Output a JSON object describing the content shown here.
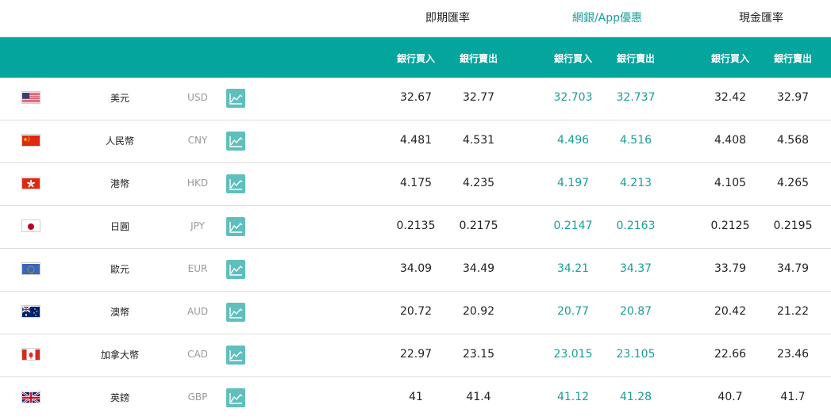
{
  "header": {
    "spot": "即期匯率",
    "online": "網銀/App優惠",
    "cash": "現金匯率",
    "buy": "銀行買入",
    "sell": "銀行賣出"
  },
  "colors": {
    "teal": "#04a59d",
    "online_text": "#179e98",
    "icon_bg": "#5ebfbc"
  },
  "rows": [
    {
      "name": "美元",
      "code": "USD",
      "flag": "us-flag",
      "spot_buy": "32.67",
      "spot_sell": "32.77",
      "online_buy": "32.703",
      "online_sell": "32.737",
      "cash_buy": "32.42",
      "cash_sell": "32.97",
      "icon": "trend-chart-icon"
    },
    {
      "name": "人民幣",
      "code": "CNY",
      "flag": "cn-flag",
      "spot_buy": "4.481",
      "spot_sell": "4.531",
      "online_buy": "4.496",
      "online_sell": "4.516",
      "cash_buy": "4.408",
      "cash_sell": "4.568",
      "icon": "trend-chart-icon"
    },
    {
      "name": "港幣",
      "code": "HKD",
      "flag": "hk-flag",
      "spot_buy": "4.175",
      "spot_sell": "4.235",
      "online_buy": "4.197",
      "online_sell": "4.213",
      "cash_buy": "4.105",
      "cash_sell": "4.265",
      "icon": "trend-chart-icon"
    },
    {
      "name": "日圓",
      "code": "JPY",
      "flag": "jp-flag",
      "spot_buy": "0.2135",
      "spot_sell": "0.2175",
      "online_buy": "0.2147",
      "online_sell": "0.2163",
      "cash_buy": "0.2125",
      "cash_sell": "0.2195",
      "icon": "trend-chart-icon"
    },
    {
      "name": "歐元",
      "code": "EUR",
      "flag": "eu-flag",
      "spot_buy": "34.09",
      "spot_sell": "34.49",
      "online_buy": "34.21",
      "online_sell": "34.37",
      "cash_buy": "33.79",
      "cash_sell": "34.79",
      "icon": "trend-chart-icon"
    },
    {
      "name": "澳幣",
      "code": "AUD",
      "flag": "au-flag",
      "spot_buy": "20.72",
      "spot_sell": "20.92",
      "online_buy": "20.77",
      "online_sell": "20.87",
      "cash_buy": "20.42",
      "cash_sell": "21.22",
      "icon": "trend-chart-icon"
    },
    {
      "name": "加拿大幣",
      "code": "CAD",
      "flag": "ca-flag",
      "spot_buy": "22.97",
      "spot_sell": "23.15",
      "online_buy": "23.015",
      "online_sell": "23.105",
      "cash_buy": "22.66",
      "cash_sell": "23.46",
      "icon": "trend-chart-icon"
    },
    {
      "name": "英鎊",
      "code": "GBP",
      "flag": "gb-flag",
      "spot_buy": "41",
      "spot_sell": "41.4",
      "online_buy": "41.12",
      "online_sell": "41.28",
      "cash_buy": "40.7",
      "cash_sell": "41.7",
      "icon": "trend-chart-icon"
    }
  ]
}
